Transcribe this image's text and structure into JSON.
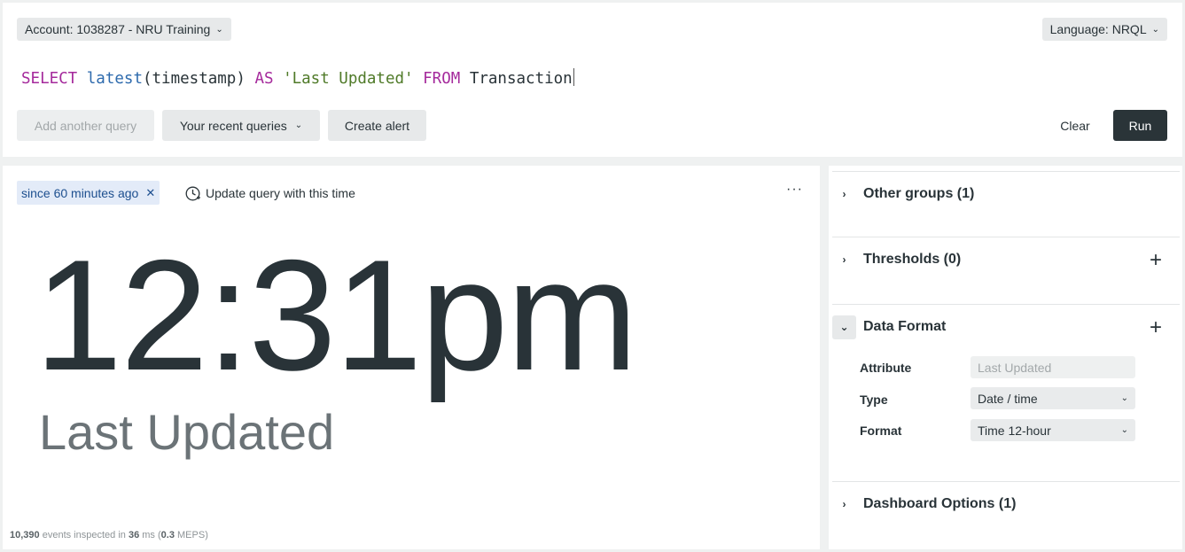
{
  "header": {
    "account_label": "Account: 1038287 - NRU Training",
    "language_label": "Language: NRQL"
  },
  "query": {
    "select_kw": "SELECT",
    "func": "latest",
    "args": "(timestamp)",
    "as_kw": "AS",
    "alias": "'Last Updated'",
    "from_kw": "FROM",
    "table": "Transaction"
  },
  "toolbar": {
    "add_query": "Add another query",
    "recent_queries": "Your recent queries",
    "create_alert": "Create alert",
    "clear": "Clear",
    "run": "Run"
  },
  "chart": {
    "time_chip": "since 60 minutes ago",
    "update_time": "Update query with this time",
    "value": "12:31pm",
    "label": "Last Updated",
    "stats_events": "10,390",
    "stats_events_text": "events inspected in",
    "stats_ms": "36",
    "stats_ms_text": "ms (",
    "stats_meps": "0.3",
    "stats_meps_text": "MEPS)"
  },
  "side": {
    "other_groups": "Other groups (1)",
    "thresholds": "Thresholds (0)",
    "data_format": "Data Format",
    "attribute_label": "Attribute",
    "attribute_value": "Last Updated",
    "type_label": "Type",
    "type_value": "Date / time",
    "format_label": "Format",
    "format_value": "Time 12-hour",
    "dashboard_options": "Dashboard Options (1)"
  },
  "colors": {
    "keyword": "#a52a9c",
    "function": "#2d6aad",
    "string": "#4f7a28",
    "run_button": "#2a3438",
    "time_chip_bg": "#e3ebf8"
  },
  "icons": [
    "chevron-down-icon",
    "close-icon",
    "clock-icon",
    "more-icon",
    "chevron-right-icon",
    "plus-icon"
  ]
}
